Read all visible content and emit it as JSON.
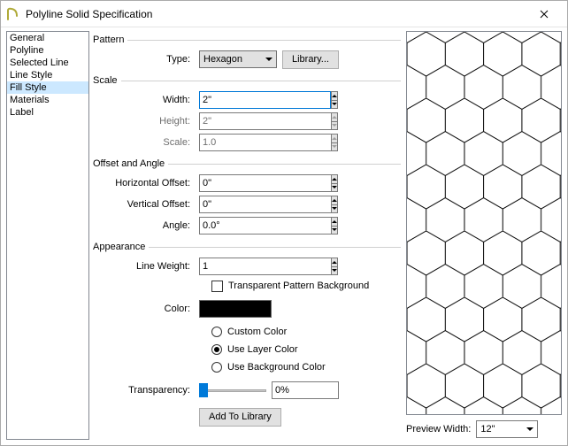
{
  "title": "Polyline Solid Specification",
  "sidebar": {
    "items": [
      {
        "label": "General"
      },
      {
        "label": "Polyline"
      },
      {
        "label": "Selected Line"
      },
      {
        "label": "Line Style"
      },
      {
        "label": "Fill Style"
      },
      {
        "label": "Materials"
      },
      {
        "label": "Label"
      }
    ],
    "selected": 4
  },
  "groups": {
    "pattern": "Pattern",
    "scale": "Scale",
    "offset": "Offset and Angle",
    "appearance": "Appearance"
  },
  "labels": {
    "type": "Type:",
    "library": "Library...",
    "width": "Width:",
    "height": "Height:",
    "scale": "Scale:",
    "h_offset": "Horizontal Offset:",
    "v_offset": "Vertical Offset:",
    "angle": "Angle:",
    "line_weight": "Line Weight:",
    "transparent_bg": "Transparent Pattern Background",
    "color": "Color:",
    "custom_color": "Custom Color",
    "use_layer_color": "Use Layer Color",
    "use_bg_color": "Use Background Color",
    "transparency": "Transparency:",
    "add_to_library": "Add To Library",
    "preview_width": "Preview Width:"
  },
  "values": {
    "type": "Hexagon",
    "width": "2\"",
    "height": "2\"",
    "scale": "1.0",
    "h_offset": "0\"",
    "v_offset": "0\"",
    "angle": "0.0°",
    "line_weight": "1",
    "transparency": "0%",
    "preview_width": "12\"",
    "color_swatch": "#000000",
    "color_mode": "use_layer_color"
  }
}
